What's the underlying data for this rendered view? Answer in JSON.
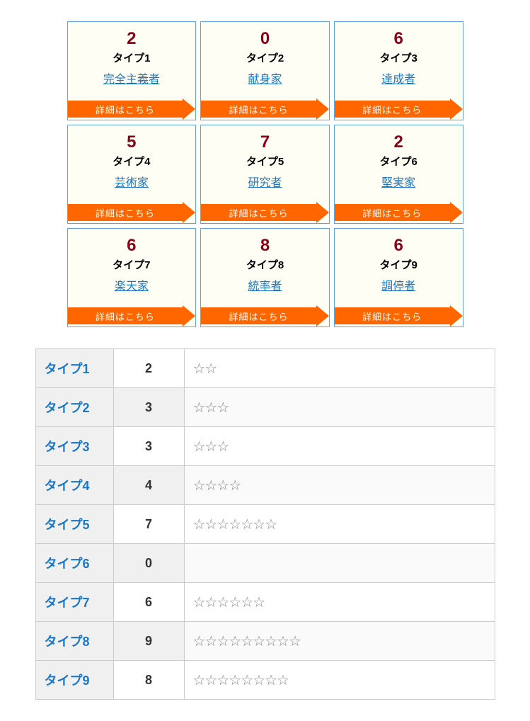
{
  "detail_label": "詳細はこちら",
  "star_glyph": "☆",
  "cards": [
    {
      "score": "2",
      "type": "タイプ1",
      "name": "完全主義者"
    },
    {
      "score": "0",
      "type": "タイプ2",
      "name": "献身家"
    },
    {
      "score": "6",
      "type": "タイプ3",
      "name": "達成者"
    },
    {
      "score": "5",
      "type": "タイプ4",
      "name": "芸術家"
    },
    {
      "score": "7",
      "type": "タイプ5",
      "name": "研究者"
    },
    {
      "score": "2",
      "type": "タイプ6",
      "name": "堅実家"
    },
    {
      "score": "6",
      "type": "タイプ7",
      "name": "楽天家"
    },
    {
      "score": "8",
      "type": "タイプ8",
      "name": "統率者"
    },
    {
      "score": "6",
      "type": "タイプ9",
      "name": "調停者"
    }
  ],
  "table": [
    {
      "type": "タイプ1",
      "score": 2
    },
    {
      "type": "タイプ2",
      "score": 3
    },
    {
      "type": "タイプ3",
      "score": 3
    },
    {
      "type": "タイプ4",
      "score": 4
    },
    {
      "type": "タイプ5",
      "score": 7
    },
    {
      "type": "タイプ6",
      "score": 0
    },
    {
      "type": "タイプ7",
      "score": 6
    },
    {
      "type": "タイプ8",
      "score": 9
    },
    {
      "type": "タイプ9",
      "score": 8
    }
  ]
}
